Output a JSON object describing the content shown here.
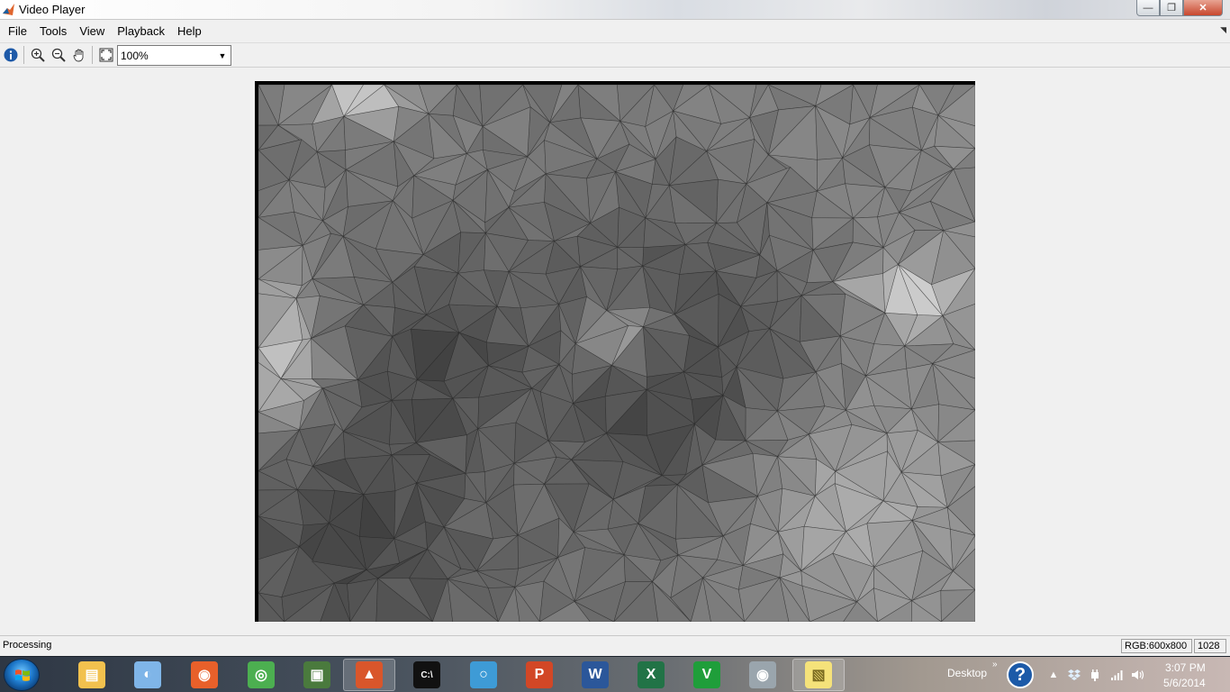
{
  "window": {
    "title": "Video Player"
  },
  "menu": {
    "items": [
      "File",
      "Tools",
      "View",
      "Playback",
      "Help"
    ]
  },
  "toolbar": {
    "buttons": [
      "info-icon",
      "zoom-in-icon",
      "zoom-out-icon",
      "pan-hand-icon",
      "fit-to-window-icon"
    ],
    "zoom_value": "100%"
  },
  "status": {
    "text": "Processing",
    "image_info": "RGB:600x800",
    "frame_number": "1028"
  },
  "taskbar": {
    "apps": [
      {
        "name": "windows-explorer",
        "icon": "folder-icon",
        "color": "#f2c14e"
      },
      {
        "name": "paint",
        "icon": "paint-palette-icon",
        "color": "#7fb5e8"
      },
      {
        "name": "firefox",
        "icon": "firefox-icon",
        "color": "#e8602a"
      },
      {
        "name": "chrome",
        "icon": "chrome-icon",
        "color": "#4caf50"
      },
      {
        "name": "task-manager",
        "icon": "monitor-icon",
        "color": "#4a7a3d"
      },
      {
        "name": "matlab",
        "icon": "matlab-icon",
        "color": "#d9562b"
      },
      {
        "name": "command-prompt",
        "icon": "cmd-icon",
        "color": "#111111"
      },
      {
        "name": "app-circle",
        "icon": "globe-icon",
        "color": "#3e9bd6"
      },
      {
        "name": "powerpoint",
        "icon": "powerpoint-icon",
        "color": "#d24726"
      },
      {
        "name": "word",
        "icon": "word-icon",
        "color": "#2b579a"
      },
      {
        "name": "excel",
        "icon": "excel-icon",
        "color": "#217346"
      },
      {
        "name": "vfm",
        "icon": "vfm-icon",
        "color": "#1f9e3a"
      },
      {
        "name": "eye-app",
        "icon": "eye-icon",
        "color": "#9aa5ad"
      },
      {
        "name": "sticky-notes",
        "icon": "sticky-notes-icon",
        "color": "#f5e27a"
      }
    ],
    "desktop_label": "Desktop",
    "clock_time": "3:07 PM",
    "clock_date": "5/6/2014"
  }
}
